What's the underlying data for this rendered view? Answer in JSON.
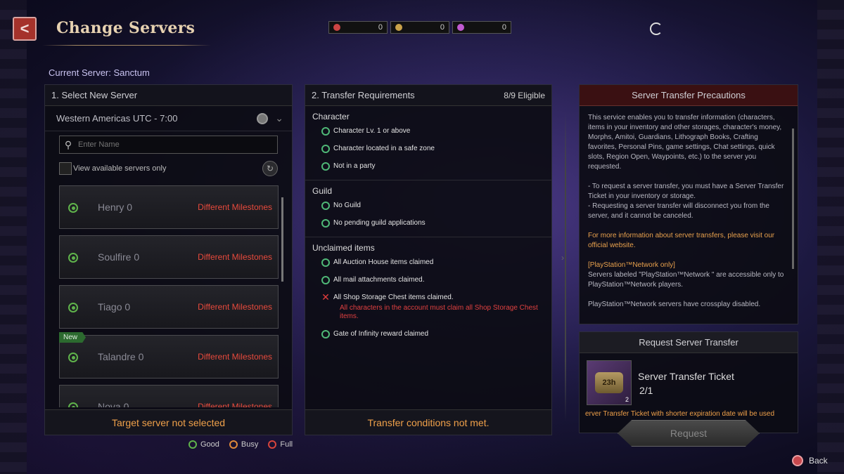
{
  "header": {
    "title": "Change Servers",
    "back_icon": "back-arrow-icon"
  },
  "currencies": [
    {
      "icon": "red-currency-icon",
      "value": "0",
      "color": "#c44"
    },
    {
      "icon": "gold-coin-icon",
      "value": "0",
      "color": "#c9a24a"
    },
    {
      "icon": "purple-gem-icon",
      "value": "0",
      "color": "#c05ad0"
    }
  ],
  "current_server": "Current Server: Sanctum",
  "select": {
    "title": "1. Select New Server",
    "region": "Western Americas UTC - 7:00",
    "search_placeholder": "Enter Name",
    "filter_label": "View available servers only",
    "servers": [
      {
        "name": "Henry",
        "count": "0",
        "status": "Different Milestones",
        "new": ""
      },
      {
        "name": "Soulfire",
        "count": "0",
        "status": "Different Milestones",
        "new": ""
      },
      {
        "name": "Tiago",
        "count": "0",
        "status": "Different Milestones",
        "new": ""
      },
      {
        "name": "Talandre",
        "count": "0",
        "status": "Different Milestones",
        "new": "New"
      },
      {
        "name": "Nova",
        "count": "0",
        "status": "Different Milestones",
        "new": ""
      }
    ],
    "footer": "Target server not selected"
  },
  "legend": {
    "good": "Good",
    "busy": "Busy",
    "full": "Full"
  },
  "requirements": {
    "title": "2. Transfer Requirements",
    "eligible": "8/9 Eligible",
    "character_title": "Character",
    "character": [
      "Character Lv. 1 or above",
      "Character located in a safe zone",
      "Not in a party"
    ],
    "guild_title": "Guild",
    "guild": [
      "No Guild",
      "No pending guild applications"
    ],
    "items_title": "Unclaimed items",
    "items": [
      "All Auction House items claimed",
      "All mail attachments claimed.",
      "All Shop Storage Chest items claimed.",
      "Gate of Infinity reward claimed"
    ],
    "warning": "All characters in the account must claim all Shop Storage Chest items.",
    "footer": "Transfer conditions not met."
  },
  "precautions": {
    "title": "Server Transfer Precautions",
    "p1": "This service enables you to transfer information (characters, items in your inventory and other storages, character's money, Morphs, Amitoi, Guardians, Lithograph Books, Crafting favorites, Personal Pins, game settings, Chat settings, quick slots, Region Open, Waypoints, etc.) to the server you requested.",
    "p2a": "- To request a server transfer, you must have a Server Transfer Ticket in your inventory or storage.",
    "p2b": "- Requesting a server transfer will disconnect you from the server, and it cannot be canceled.",
    "p3": "For more information about server transfers, please visit our official website.",
    "p4_title": "[PlayStation™Network only]",
    "p4": "Servers labeled \"PlayStation™Network \" are accessible only to PlayStation™Network players.",
    "p5": "PlayStation™Network servers have crossplay disabled."
  },
  "request": {
    "title": "Request Server Transfer",
    "ticket_name": "Server Transfer Ticket",
    "ticket_qty": "2/1",
    "ticket_time": "23h",
    "ticket_count": "2",
    "note": "erver Transfer Ticket with shorter expiration date will be used",
    "button": "Request"
  },
  "back_label": "Back"
}
